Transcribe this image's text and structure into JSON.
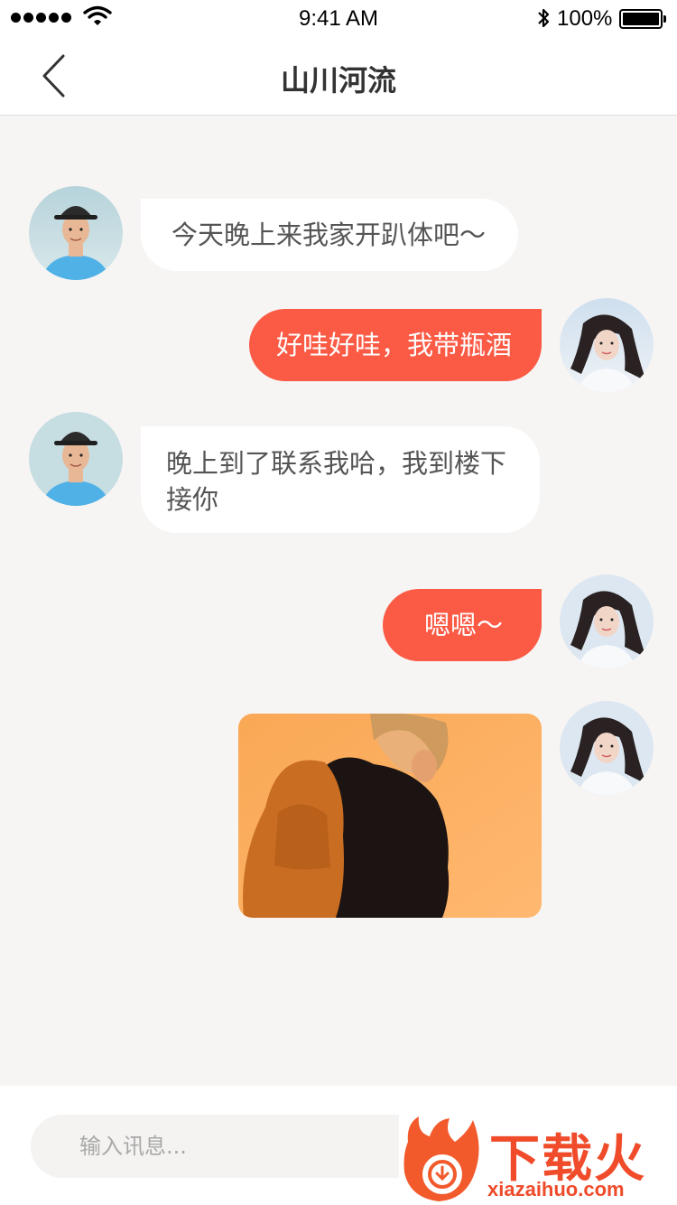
{
  "status_bar": {
    "time": "9:41 AM",
    "battery": "100%",
    "icons": [
      "signal-dots-icon",
      "wifi-icon",
      "bluetooth-icon",
      "battery-icon"
    ]
  },
  "nav": {
    "title": "山川河流",
    "back_icon": "chevron-left-icon"
  },
  "messages": [
    {
      "side": "in",
      "sender": "friend",
      "text": "今天晚上来我家开趴体吧～"
    },
    {
      "side": "out",
      "sender": "me",
      "text": "好哇好哇，我带瓶酒"
    },
    {
      "side": "in",
      "sender": "friend",
      "text_line1": "晚上到了联系我哈，我到楼下",
      "text_line2": "接你"
    },
    {
      "side": "out",
      "sender": "me",
      "text": "嗯嗯～"
    },
    {
      "side": "out",
      "sender": "me",
      "type": "image"
    }
  ],
  "composer": {
    "placeholder": "输入讯息..."
  },
  "watermark": {
    "brand": "下载火",
    "domain": "xiazaihuo.com"
  },
  "colors": {
    "accent": "#fb5a45",
    "chat_background": "#f7f5f4",
    "incoming_bubble": "#ffffff"
  }
}
